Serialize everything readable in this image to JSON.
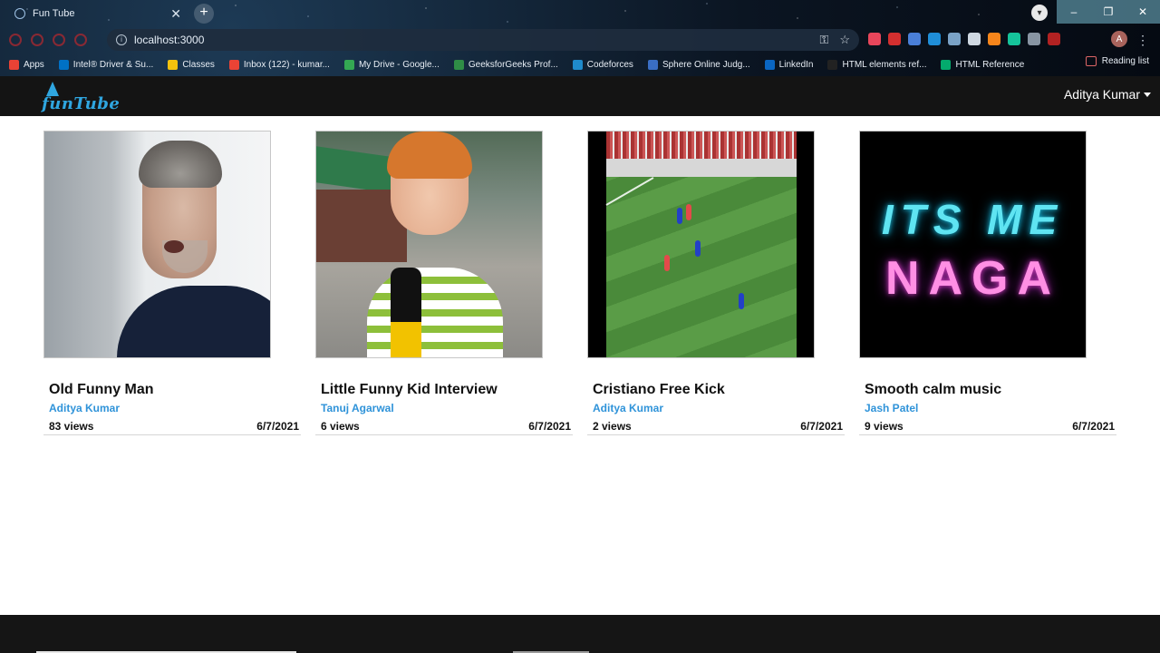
{
  "browser": {
    "tab_title": "Fun Tube",
    "tab_close": "✕",
    "new_tab": "+",
    "url": "localhost:3000",
    "profile_initial": "A",
    "window_controls": [
      "–",
      "❐",
      "✕"
    ],
    "bookmarks": [
      {
        "label": "Apps",
        "color": "#e94235"
      },
      {
        "label": "Intel® Driver & Su...",
        "color": "#0071c5"
      },
      {
        "label": "Classes",
        "color": "#f4c20d"
      },
      {
        "label": "Inbox (122) - kumar...",
        "color": "#ea4335"
      },
      {
        "label": "My Drive - Google...",
        "color": "#34a853"
      },
      {
        "label": "GeeksforGeeks Prof...",
        "color": "#2f8d46"
      },
      {
        "label": "Codeforces",
        "color": "#1f8acb"
      },
      {
        "label": "Sphere Online Judg...",
        "color": "#3a6ec4"
      },
      {
        "label": "LinkedIn",
        "color": "#0a66c2"
      },
      {
        "label": "HTML elements ref...",
        "color": "#222222"
      },
      {
        "label": "HTML Reference",
        "color": "#04aa6d"
      }
    ],
    "reading_list": "Reading list"
  },
  "header": {
    "logo_text": "funTube",
    "user_name": "Aditya Kumar"
  },
  "videos": [
    {
      "title": "Old Funny Man",
      "author": "Aditya Kumar",
      "views": "83 views",
      "date": "6/7/2021"
    },
    {
      "title": "Little Funny Kid Interview",
      "author": "Tanuj Agarwal",
      "views": "6 views",
      "date": "6/7/2021"
    },
    {
      "title": "Cristiano Free Kick",
      "author": "Aditya Kumar",
      "views": "2 views",
      "date": "6/7/2021"
    },
    {
      "title": "Smooth calm music",
      "author": "Jash Patel",
      "views": "9 views",
      "date": "6/7/2021"
    }
  ],
  "thumb4": {
    "line1": "ITS ME",
    "line2": "NAGA"
  },
  "colors": {
    "accent": "#2f93d9",
    "header_bg": "#141414"
  }
}
